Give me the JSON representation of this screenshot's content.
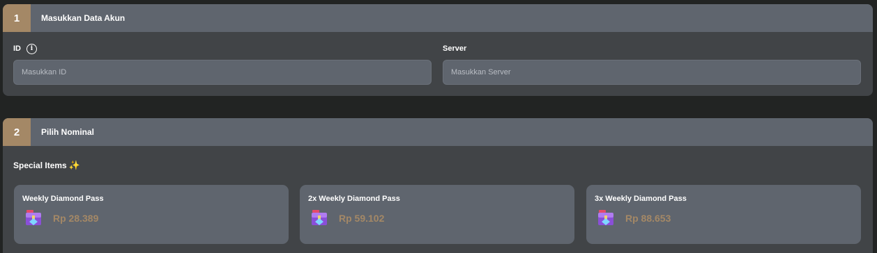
{
  "step1": {
    "number": "1",
    "title": "Masukkan Data Akun",
    "id_label": "ID",
    "id_placeholder": "Masukkan ID",
    "server_label": "Server",
    "server_placeholder": "Masukkan Server"
  },
  "step2": {
    "number": "2",
    "title": "Pilih Nominal",
    "group_title": "Special Items",
    "group_icon": "sparkle-icon",
    "items": [
      {
        "name": "Weekly Diamond Pass",
        "price": "Rp 28.389",
        "icon": "diamond-chest-icon"
      },
      {
        "name": "2x Weekly Diamond Pass",
        "price": "Rp 59.102",
        "icon": "diamond-chest-icon"
      },
      {
        "name": "3x Weekly Diamond Pass",
        "price": "Rp 88.653",
        "icon": "diamond-chest-icon"
      }
    ]
  },
  "colors": {
    "accent": "#a48866",
    "header": "#5f656e",
    "panel": "#414447",
    "background": "#222423"
  }
}
